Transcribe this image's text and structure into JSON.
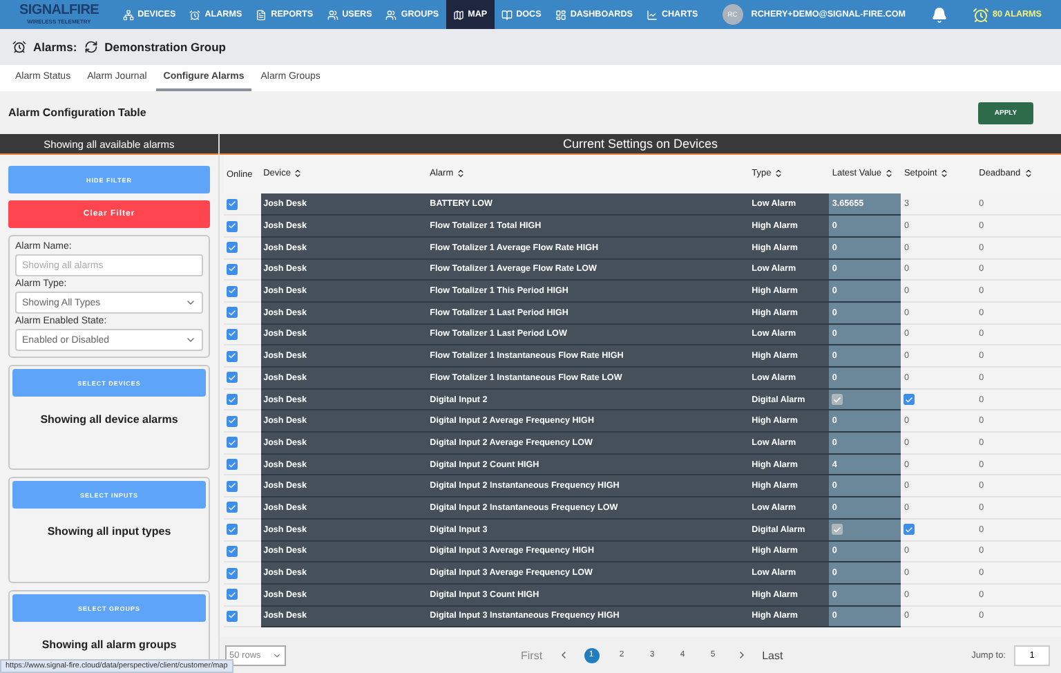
{
  "nav": {
    "logo": "SIGNALFIRE",
    "logo_sub": "WIRELESS TELEMETRY",
    "items": [
      {
        "label": "DEVICES",
        "selected": false
      },
      {
        "label": "ALARMS",
        "selected": false
      },
      {
        "label": "REPORTS",
        "selected": false
      },
      {
        "label": "USERS",
        "selected": false
      },
      {
        "label": "GROUPS",
        "selected": false
      },
      {
        "label": "MAP",
        "selected": true
      },
      {
        "label": "DOCS",
        "selected": false
      },
      {
        "label": "DASHBOARDS",
        "selected": false
      },
      {
        "label": "CHARTS",
        "selected": false
      }
    ],
    "user_initials": "RC",
    "user": "RCHERY+DEMO@SIGNAL-FIRE.COM",
    "alarm_count": "80 ALARMS"
  },
  "header": {
    "label": "Alarms:",
    "group": "Demonstration Group"
  },
  "tabs": [
    {
      "label": "Alarm Status",
      "selected": false
    },
    {
      "label": "Alarm Journal",
      "selected": false
    },
    {
      "label": "Configure Alarms",
      "selected": true
    },
    {
      "label": "Alarm Groups",
      "selected": false
    }
  ],
  "config_title": "Alarm Configuration Table",
  "apply": "APPLY",
  "filter": {
    "title": "Showing all available alarms",
    "hide": "HIDE FILTER",
    "clear": "Clear Filter",
    "name_label": "Alarm Name:",
    "name_placeholder": "Showing all alarms",
    "type_label": "Alarm Type:",
    "type_value": "Showing All Types",
    "state_label": "Alarm Enabled State:",
    "state_value": "Enabled or Disabled",
    "sections": [
      {
        "button": "SELECT DEVICES",
        "text": "Showing all device alarms"
      },
      {
        "button": "SELECT INPUTS",
        "text": "Showing all input types"
      },
      {
        "button": "SELECT GROUPS",
        "text": "Showing all alarm groups"
      }
    ]
  },
  "table": {
    "title": "Current Settings on Devices",
    "columns": [
      "Online",
      "Device",
      "Alarm",
      "Type",
      "Latest Value",
      "Setpoint",
      "Deadband"
    ],
    "rows": [
      {
        "kind": "numeric",
        "online": true,
        "device": "Josh Desk",
        "alarm": "BATTERY LOW",
        "type": "Low Alarm",
        "latest": "3.65655",
        "setpoint": "3",
        "deadband": "0"
      },
      {
        "kind": "numeric",
        "online": true,
        "device": "Josh Desk",
        "alarm": "Flow Totalizer 1 Total HIGH",
        "type": "High Alarm",
        "latest": "0",
        "setpoint": "0",
        "deadband": "0"
      },
      {
        "kind": "numeric",
        "online": true,
        "device": "Josh Desk",
        "alarm": "Flow Totalizer 1 Average Flow Rate HIGH",
        "type": "High Alarm",
        "latest": "0",
        "setpoint": "0",
        "deadband": "0"
      },
      {
        "kind": "numeric",
        "online": true,
        "device": "Josh Desk",
        "alarm": "Flow Totalizer 1 Average Flow Rate LOW",
        "type": "Low Alarm",
        "latest": "0",
        "setpoint": "0",
        "deadband": "0"
      },
      {
        "kind": "numeric",
        "online": true,
        "device": "Josh Desk",
        "alarm": "Flow Totalizer 1 This Period HIGH",
        "type": "High Alarm",
        "latest": "0",
        "setpoint": "0",
        "deadband": "0"
      },
      {
        "kind": "numeric",
        "online": true,
        "device": "Josh Desk",
        "alarm": "Flow Totalizer 1 Last Period HIGH",
        "type": "High Alarm",
        "latest": "0",
        "setpoint": "0",
        "deadband": "0"
      },
      {
        "kind": "numeric",
        "online": true,
        "device": "Josh Desk",
        "alarm": "Flow Totalizer 1 Last Period LOW",
        "type": "Low Alarm",
        "latest": "0",
        "setpoint": "0",
        "deadband": "0"
      },
      {
        "kind": "numeric",
        "online": true,
        "device": "Josh Desk",
        "alarm": "Flow Totalizer 1 Instantaneous Flow Rate HIGH",
        "type": "High Alarm",
        "latest": "0",
        "setpoint": "0",
        "deadband": "0"
      },
      {
        "kind": "numeric",
        "online": true,
        "device": "Josh Desk",
        "alarm": "Flow Totalizer 1 Instantaneous Flow Rate LOW",
        "type": "Low Alarm",
        "latest": "0",
        "setpoint": "0",
        "deadband": "0"
      },
      {
        "kind": "digital",
        "online": true,
        "device": "Josh Desk",
        "alarm": "Digital Input 2",
        "type": "Digital Alarm",
        "latest_checked": true,
        "setpoint_checked": true,
        "deadband": "0"
      },
      {
        "kind": "numeric",
        "online": true,
        "device": "Josh Desk",
        "alarm": "Digital Input 2 Average Frequency HIGH",
        "type": "High Alarm",
        "latest": "0",
        "setpoint": "0",
        "deadband": "0"
      },
      {
        "kind": "numeric",
        "online": true,
        "device": "Josh Desk",
        "alarm": "Digital Input 2 Average Frequency LOW",
        "type": "Low Alarm",
        "latest": "0",
        "setpoint": "0",
        "deadband": "0"
      },
      {
        "kind": "numeric",
        "online": true,
        "device": "Josh Desk",
        "alarm": "Digital Input 2 Count HIGH",
        "type": "High Alarm",
        "latest": "4",
        "setpoint": "0",
        "deadband": "0"
      },
      {
        "kind": "numeric",
        "online": true,
        "device": "Josh Desk",
        "alarm": "Digital Input 2 Instantaneous Frequency HIGH",
        "type": "High Alarm",
        "latest": "0",
        "setpoint": "0",
        "deadband": "0"
      },
      {
        "kind": "numeric",
        "online": true,
        "device": "Josh Desk",
        "alarm": "Digital Input 2 Instantaneous Frequency LOW",
        "type": "Low Alarm",
        "latest": "0",
        "setpoint": "0",
        "deadband": "0"
      },
      {
        "kind": "digital",
        "online": true,
        "device": "Josh Desk",
        "alarm": "Digital Input 3",
        "type": "Digital Alarm",
        "latest_checked": true,
        "setpoint_checked": true,
        "deadband": "0"
      },
      {
        "kind": "numeric",
        "online": true,
        "device": "Josh Desk",
        "alarm": "Digital Input 3 Average Frequency HIGH",
        "type": "High Alarm",
        "latest": "0",
        "setpoint": "0",
        "deadband": "0"
      },
      {
        "kind": "numeric",
        "online": true,
        "device": "Josh Desk",
        "alarm": "Digital Input 3 Average Frequency LOW",
        "type": "Low Alarm",
        "latest": "0",
        "setpoint": "0",
        "deadband": "0"
      },
      {
        "kind": "numeric",
        "online": true,
        "device": "Josh Desk",
        "alarm": "Digital Input 3 Count HIGH",
        "type": "High Alarm",
        "latest": "0",
        "setpoint": "0",
        "deadband": "0"
      },
      {
        "kind": "numeric",
        "online": true,
        "device": "Josh Desk",
        "alarm": "Digital Input 3 Instantaneous Frequency HIGH",
        "type": "High Alarm",
        "latest": "0",
        "setpoint": "0",
        "deadband": "0"
      }
    ]
  },
  "pager": {
    "rows_per_page": "50 rows",
    "first": "First",
    "pages": [
      {
        "label": "1",
        "selected": true
      },
      {
        "label": "2",
        "selected": false
      },
      {
        "label": "3",
        "selected": false
      },
      {
        "label": "4",
        "selected": false
      },
      {
        "label": "5",
        "selected": false
      }
    ],
    "last": "Last",
    "jump_label": "Jump to:",
    "jump_value": "1"
  },
  "status_url": "https://www.signal-fire.cloud/data/perspective/client/customer/map"
}
